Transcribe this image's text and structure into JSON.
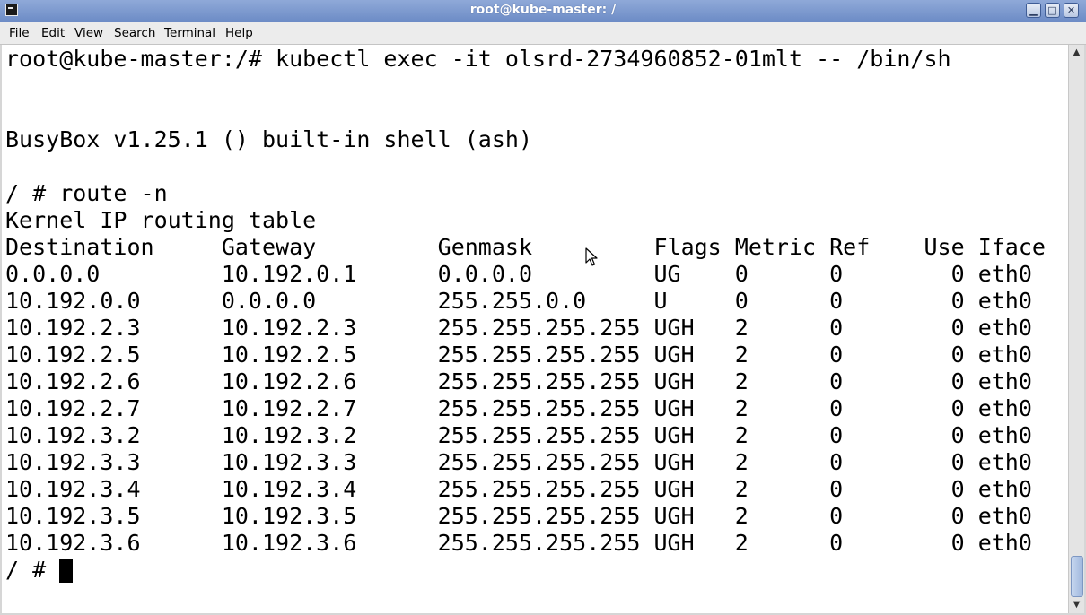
{
  "window": {
    "title": "root@kube-master: /"
  },
  "menu": [
    {
      "label": "File"
    },
    {
      "label": "Edit"
    },
    {
      "label": "View"
    },
    {
      "label": "Search"
    },
    {
      "label": "Terminal"
    },
    {
      "label": "Help"
    }
  ],
  "terminal": {
    "lines": [
      "root@kube-master:/# kubectl exec -it olsrd-2734960852-01mlt -- /bin/sh",
      "",
      "",
      "BusyBox v1.25.1 () built-in shell (ash)",
      "",
      "/ # route -n",
      "Kernel IP routing table",
      "Destination     Gateway         Genmask         Flags Metric Ref    Use Iface",
      "0.0.0.0         10.192.0.1      0.0.0.0         UG    0      0        0 eth0",
      "10.192.0.0      0.0.0.0         255.255.0.0     U     0      0        0 eth0",
      "10.192.2.3      10.192.2.3      255.255.255.255 UGH   2      0        0 eth0",
      "10.192.2.5      10.192.2.5      255.255.255.255 UGH   2      0        0 eth0",
      "10.192.2.6      10.192.2.6      255.255.255.255 UGH   2      0        0 eth0",
      "10.192.2.7      10.192.2.7      255.255.255.255 UGH   2      0        0 eth0",
      "10.192.3.2      10.192.3.2      255.255.255.255 UGH   2      0        0 eth0",
      "10.192.3.3      10.192.3.3      255.255.255.255 UGH   2      0        0 eth0",
      "10.192.3.4      10.192.3.4      255.255.255.255 UGH   2      0        0 eth0",
      "10.192.3.5      10.192.3.5      255.255.255.255 UGH   2      0        0 eth0",
      "10.192.3.6      10.192.3.6      255.255.255.255 UGH   2      0        0 eth0"
    ],
    "prompt": "/ # "
  },
  "icons": {
    "app": "terminal-icon",
    "minimize": "minimize-icon",
    "maximize": "maximize-icon",
    "close": "close-icon",
    "pointer": "mouse-pointer-icon"
  }
}
